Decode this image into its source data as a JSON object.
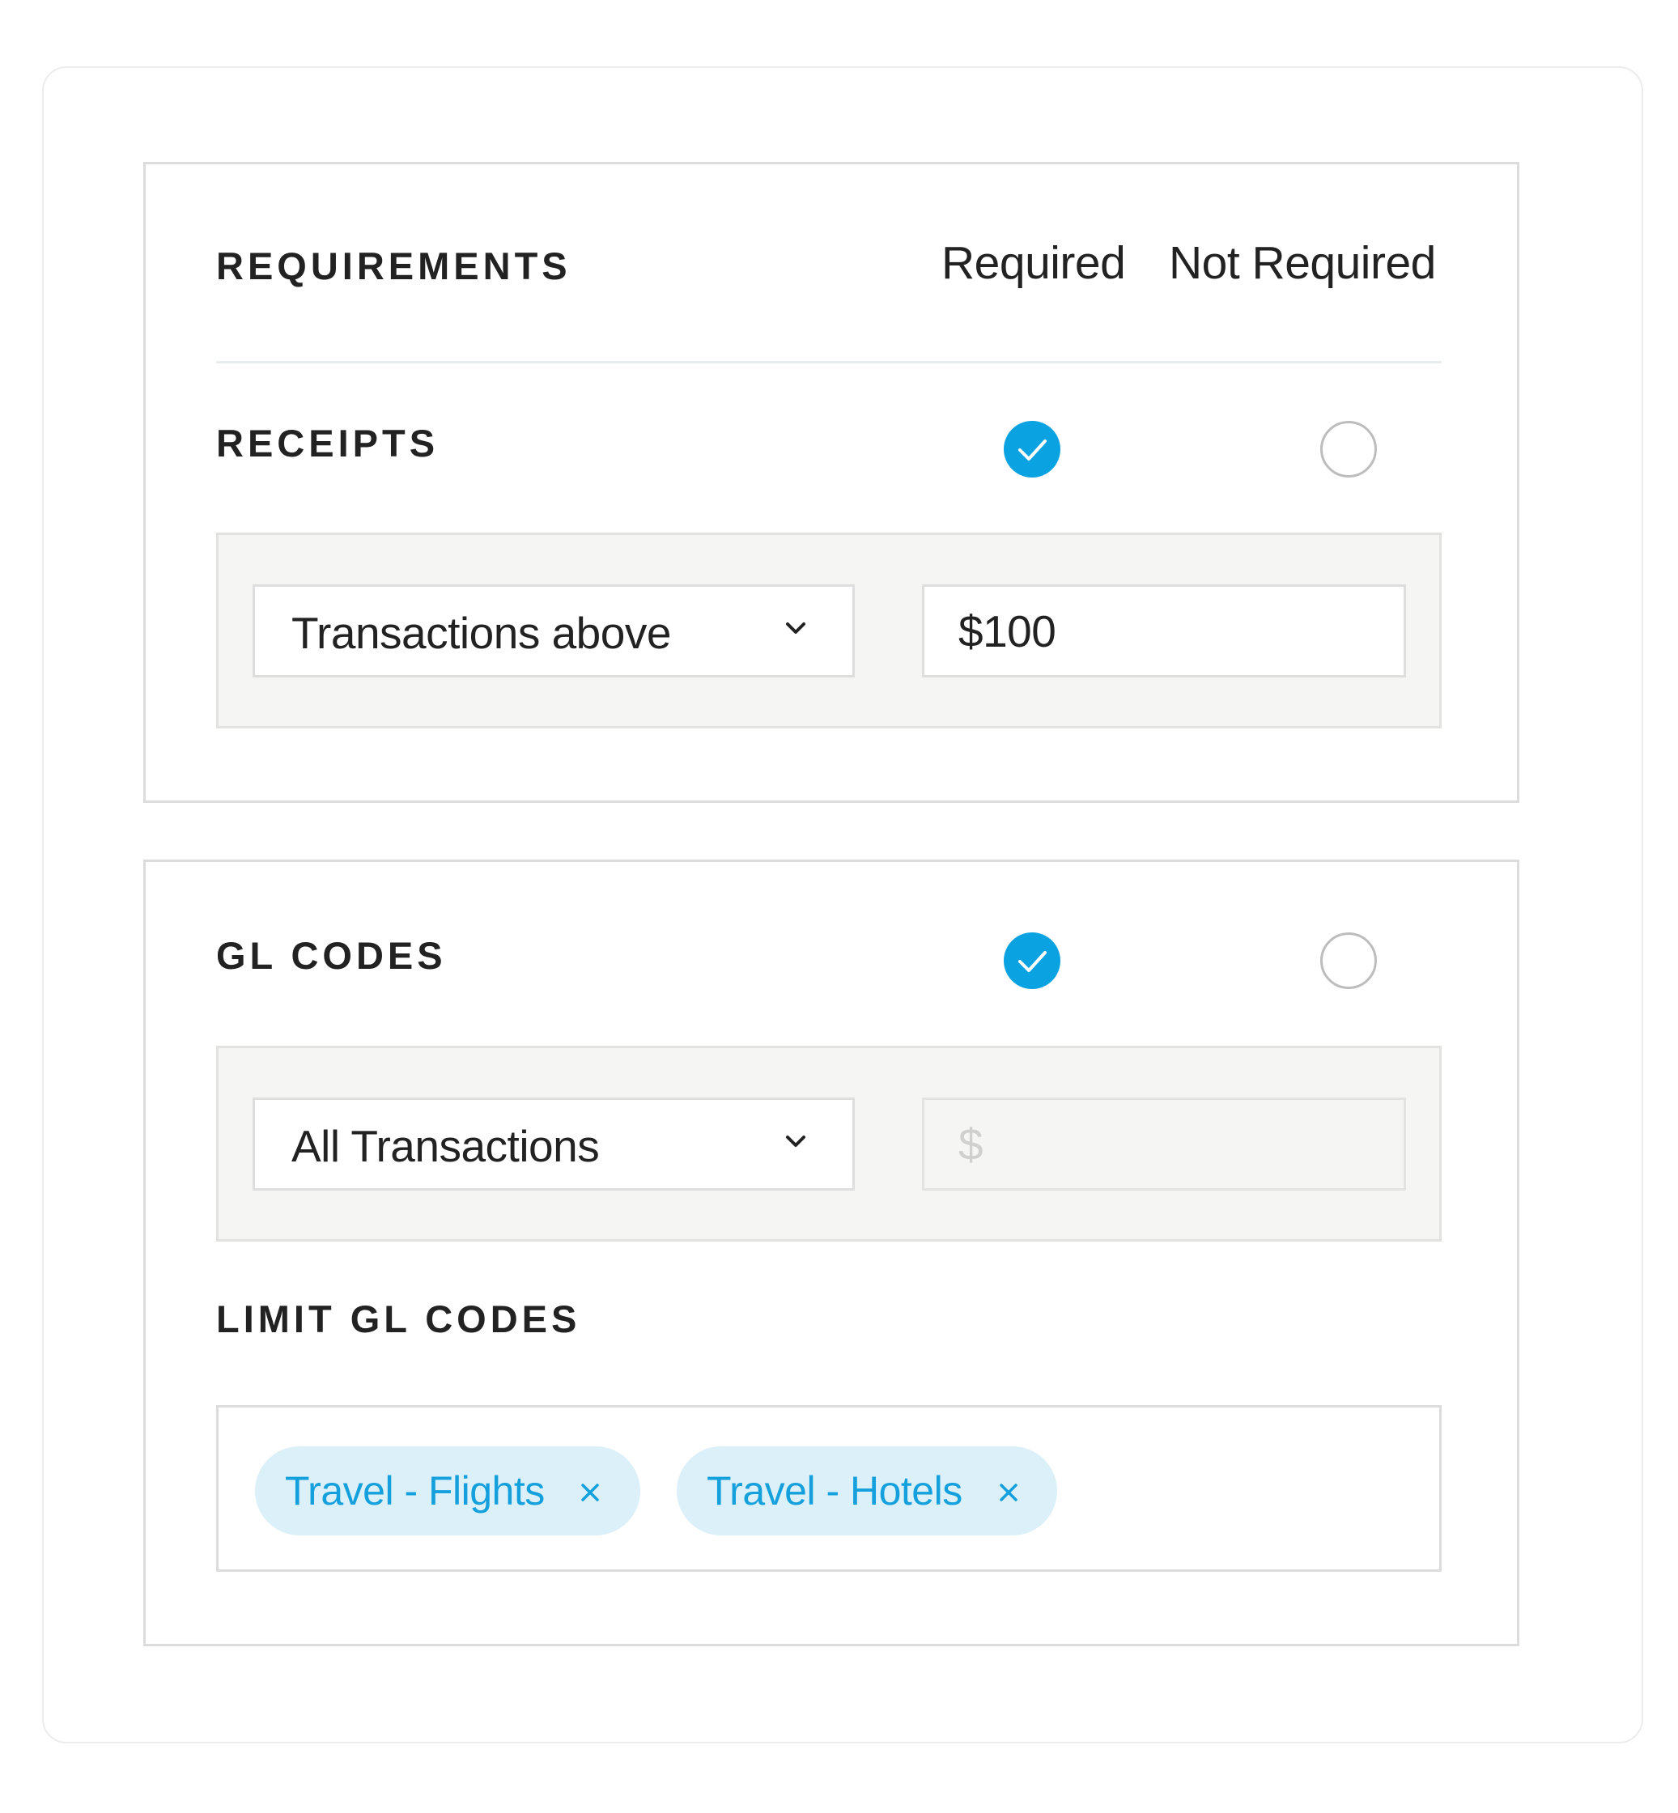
{
  "requirements": {
    "title": "REQUIREMENTS",
    "columns": {
      "required": "Required",
      "not_required": "Not Required"
    }
  },
  "receipts": {
    "title": "RECEIPTS",
    "required_selected": true,
    "condition": {
      "selected": "Transactions above"
    },
    "amount": {
      "value": "$100"
    }
  },
  "gl_codes": {
    "title": "GL CODES",
    "required_selected": true,
    "condition": {
      "selected": "All Transactions"
    },
    "amount": {
      "placeholder": "$"
    }
  },
  "limit_gl_codes": {
    "title": "LIMIT GL CODES",
    "tags": [
      {
        "label": "Travel - Flights",
        "remove_icon": "close-icon"
      },
      {
        "label": "Travel - Hotels",
        "remove_icon": "close-icon"
      }
    ]
  },
  "colors": {
    "accent": "#0aa2e1",
    "chip_bg": "#dcf0f9",
    "chip_text": "#14a0dc"
  },
  "icons": {
    "radio_checked": "check-icon",
    "dropdown": "chevron-down-icon"
  }
}
